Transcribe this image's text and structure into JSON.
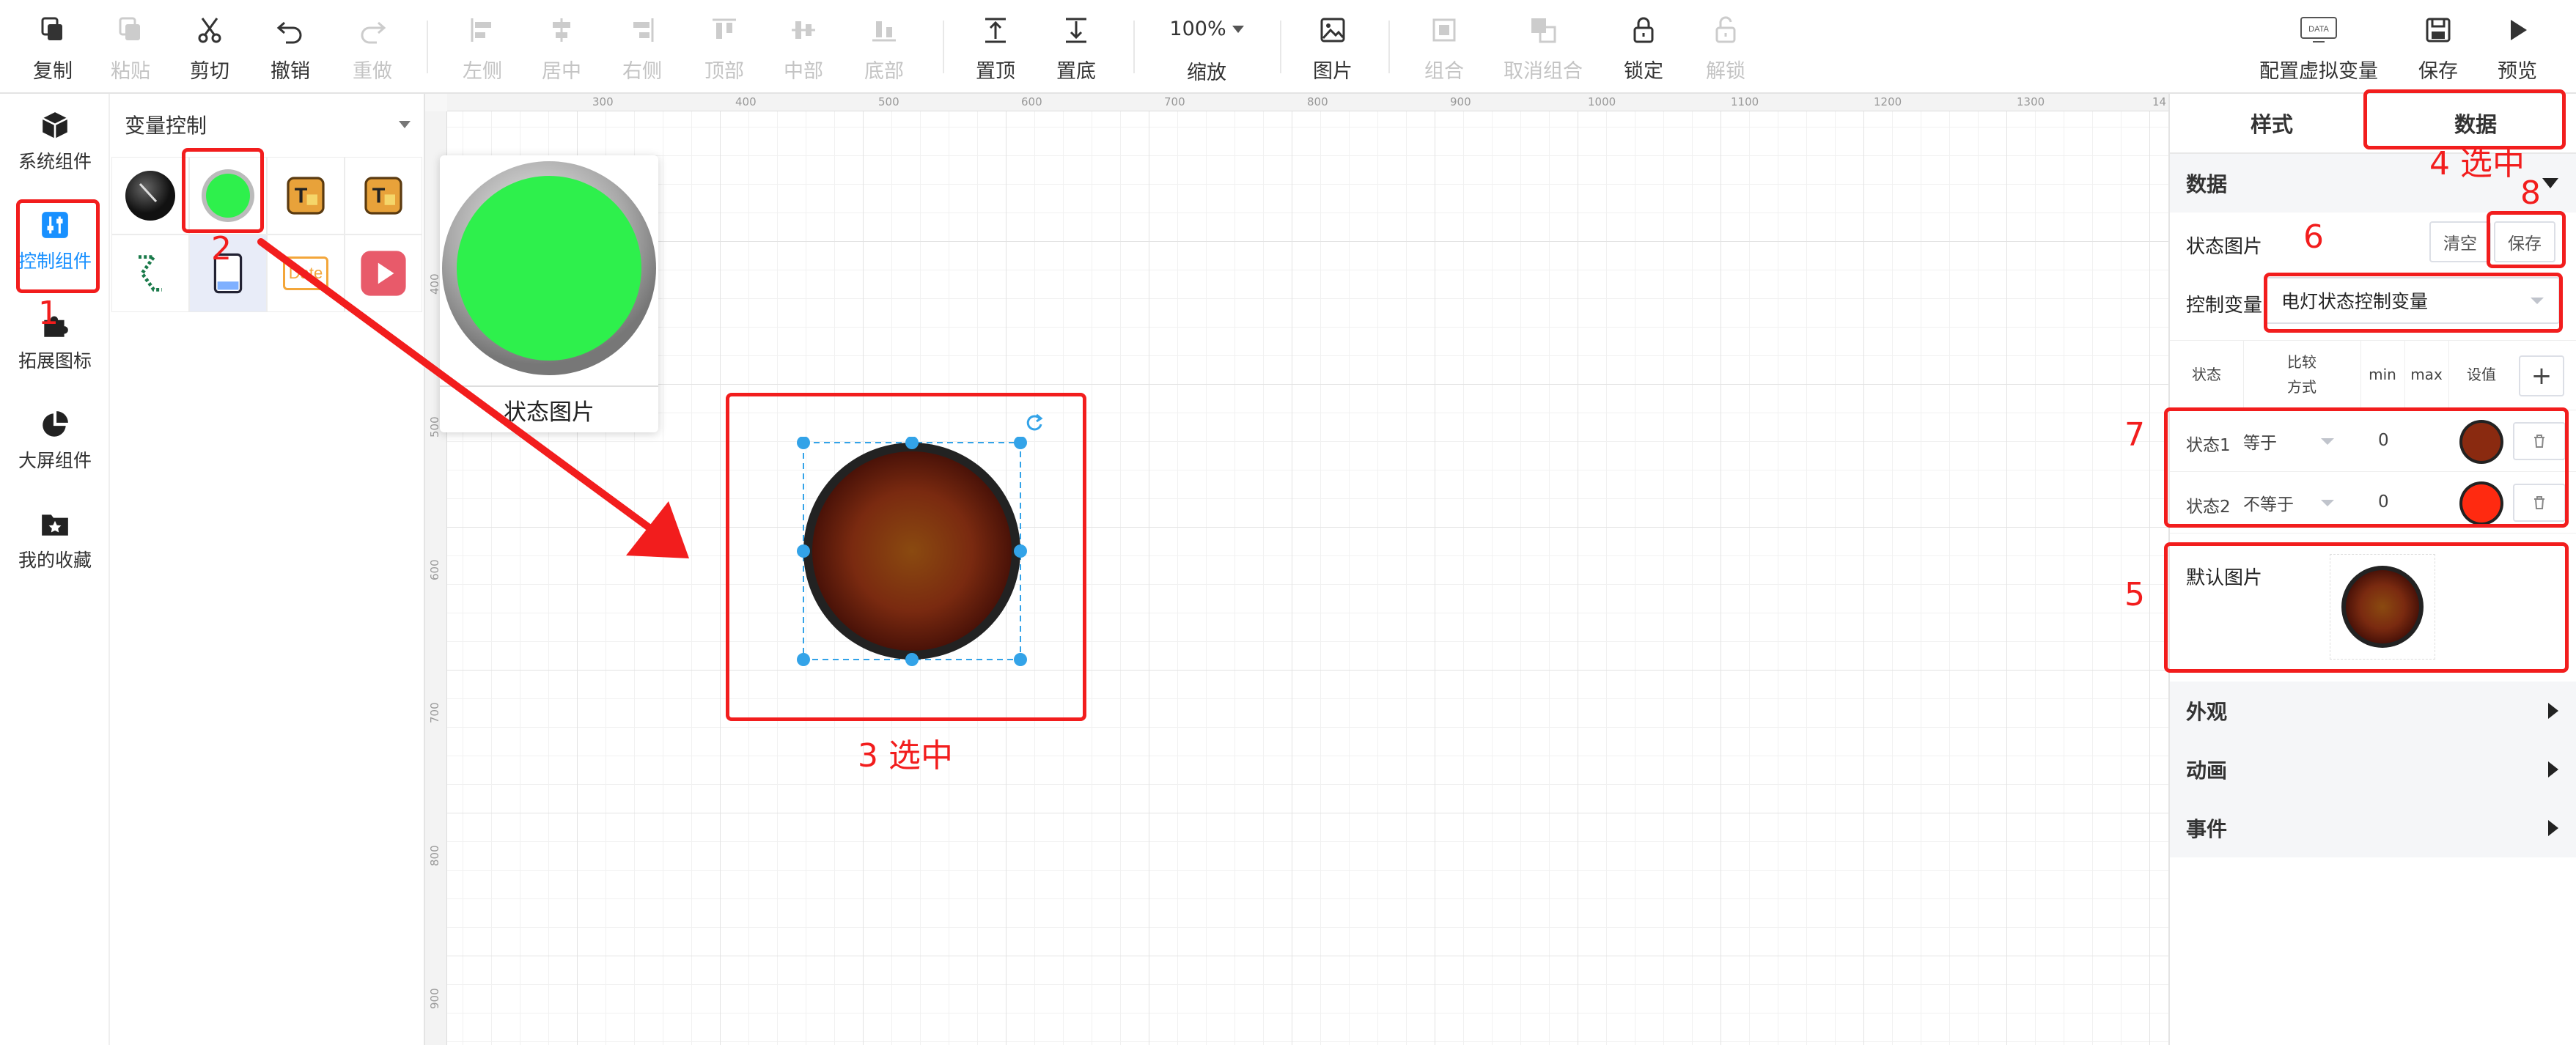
{
  "toolbar": {
    "copy": "复制",
    "paste": "粘贴",
    "cut": "剪切",
    "undo": "撤销",
    "redo": "重做",
    "align_left": "左侧",
    "align_center": "居中",
    "align_right": "右侧",
    "align_top": "顶部",
    "align_middle": "中部",
    "align_bottom": "底部",
    "bring_front": "置顶",
    "send_back": "置底",
    "zoom_value": "100%",
    "zoom": "缩放",
    "image": "图片",
    "group": "组合",
    "ungroup": "取消组合",
    "lock": "锁定",
    "unlock": "解锁",
    "virtual_var": "配置虚拟变量",
    "data_badge": "DATA",
    "save": "保存",
    "preview": "预览"
  },
  "leftnav": {
    "items": [
      {
        "label": "系统组件",
        "icon": "cube-icon"
      },
      {
        "label": "控制组件",
        "icon": "sliders-icon",
        "active": true
      },
      {
        "label": "拓展图标",
        "icon": "puzzle-icon"
      },
      {
        "label": "大屏组件",
        "icon": "pie-chart-icon"
      },
      {
        "label": "我的收藏",
        "icon": "star-folder-icon"
      }
    ]
  },
  "component_panel": {
    "title": "变量控制",
    "date_tile": "Date",
    "preview_caption": "状态图片"
  },
  "canvas": {
    "ruler_top": [
      "300",
      "400",
      "500",
      "600",
      "700",
      "800",
      "900",
      "1000",
      "1100",
      "1200",
      "1300",
      "14"
    ],
    "ruler_left": [
      "400",
      "500",
      "600",
      "700",
      "800",
      "900"
    ]
  },
  "right_panel": {
    "tab_style": "样式",
    "tab_data": "数据",
    "section_data": "数据",
    "state_image_label": "状态图片",
    "clear_btn": "清空",
    "save_btn": "保存",
    "control_var_label": "控制变量",
    "control_var_value": "电灯状态控制变量",
    "table_headers": {
      "state": "状态",
      "compare_1": "比较",
      "compare_2": "方式",
      "min": "min",
      "max": "max",
      "setvalue": "设值"
    },
    "add_btn": "+",
    "rows": [
      {
        "state": "状态1",
        "compare": "等于",
        "min": "0",
        "color": "#8a2a10"
      },
      {
        "state": "状态2",
        "compare": "不等于",
        "min": "0",
        "color": "#ff2a10"
      }
    ],
    "default_image_label": "默认图片",
    "section_appearance": "外观",
    "section_animation": "动画",
    "section_events": "事件"
  },
  "annotations": {
    "n1": "1",
    "n2": "2",
    "n3": "3 选中",
    "n4": "4 选中",
    "n5": "5",
    "n6": "6",
    "n7": "7",
    "n8": "8",
    "color": "#f21d1d"
  }
}
